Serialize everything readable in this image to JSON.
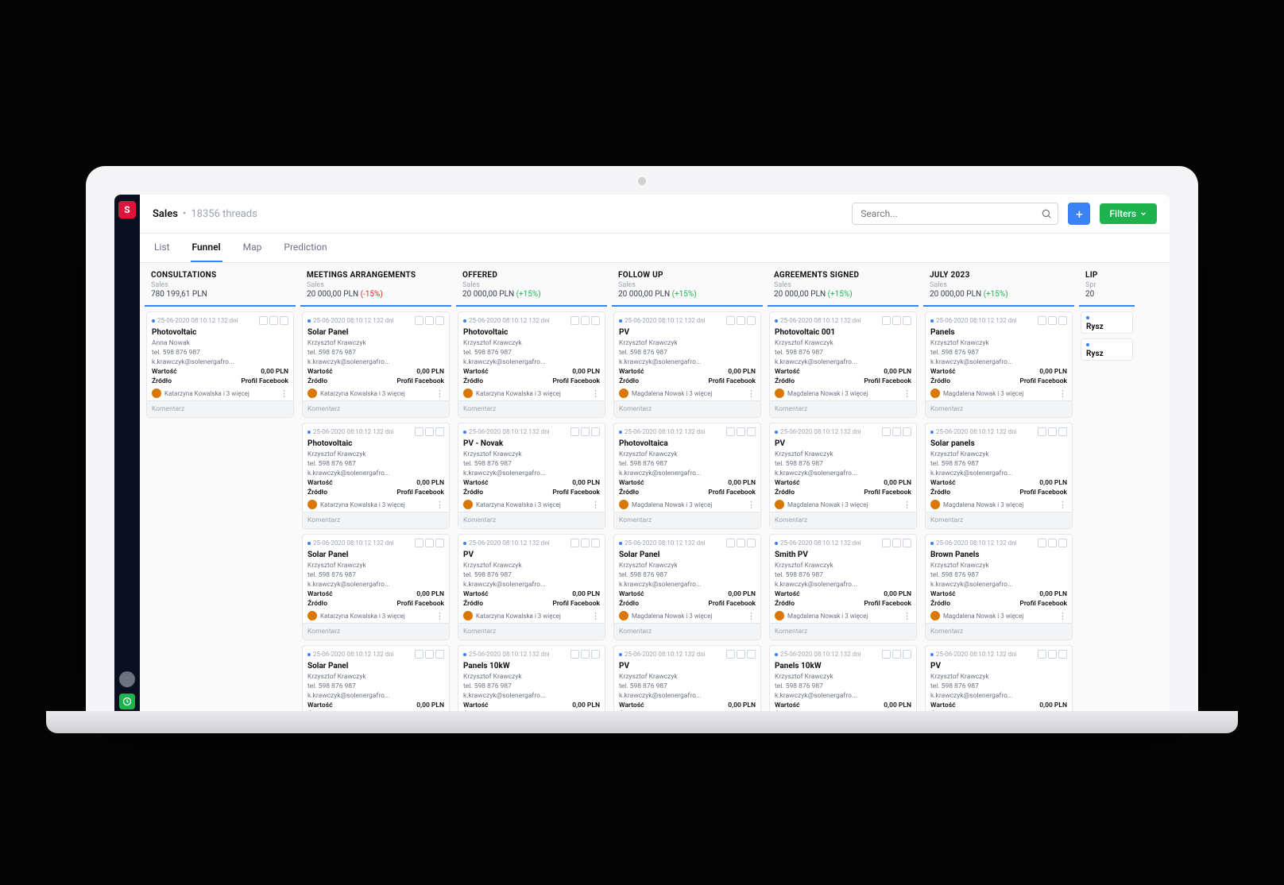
{
  "header": {
    "title": "Sales",
    "threads": "18356 threads",
    "search_ph": "Search...",
    "filters": "Filters",
    "add": "+"
  },
  "tabs": [
    {
      "label": "List"
    },
    {
      "label": "Funnel",
      "active": true
    },
    {
      "label": "Map"
    },
    {
      "label": "Prediction"
    }
  ],
  "card_common": {
    "date": "25-06-2020  08:10:12  132 dni",
    "contact": "Krzysztof Krawczyk",
    "phone": "tel. 598 876 987",
    "email": "k.krawczyk@solenergafro...",
    "wartosc_l": "Wartość",
    "wartosc_v": "0,00 PLN",
    "zrodlo_l": "Źródło",
    "zrodlo_v": "Profil Facebook",
    "komentarz": "Komentarz",
    "assignee_k": "Katarzyna Kowalska i 3 więcej",
    "assignee_m": "Magdalena Nowak i 3 więcej"
  },
  "columns": [
    {
      "name": "CONSULTATIONS",
      "sub": "Sales",
      "value": "780 199,61 PLN",
      "pct": "",
      "bar": "#3b82f6",
      "cards": [
        {
          "title": "Photovoltaic",
          "contact": "Anna Nowak",
          "asn": "k"
        }
      ]
    },
    {
      "name": "MEETINGS ARRANGEMENTS",
      "sub": "Sales",
      "value": "20 000,00 PLN",
      "pct": "(-15%)",
      "pdir": "dn",
      "bar": "#3b82f6",
      "cards": [
        {
          "title": "Solar Panel",
          "asn": "k"
        },
        {
          "title": "Photovoltaic",
          "asn": "k"
        },
        {
          "title": "Solar Panel",
          "asn": "k"
        },
        {
          "title": "Solar Panel",
          "asn": "k"
        }
      ]
    },
    {
      "name": "OFFERED",
      "sub": "Sales",
      "value": "20 000,00 PLN",
      "pct": "(+15%)",
      "pdir": "up",
      "bar": "#3b82f6",
      "cards": [
        {
          "title": "Photovoltaic",
          "asn": "k"
        },
        {
          "title": "PV - Novak",
          "asn": "k"
        },
        {
          "title": "PV",
          "asn": "k"
        },
        {
          "title": "Panels 10kW",
          "asn": "k"
        }
      ]
    },
    {
      "name": "FOLLOW UP",
      "sub": "Sales",
      "value": "20 000,00 PLN",
      "pct": "(+15%)",
      "pdir": "up",
      "bar": "#3b82f6",
      "cards": [
        {
          "title": "PV",
          "asn": "m"
        },
        {
          "title": "Photovoltaica",
          "asn": "m"
        },
        {
          "title": "Solar Panel",
          "asn": "m"
        },
        {
          "title": "PV",
          "asn": "k"
        }
      ]
    },
    {
      "name": "AGREEMENTS SIGNED",
      "sub": "Sales",
      "value": "20 000,00 PLN",
      "pct": "(+15%)",
      "pdir": "up",
      "bar": "#3b82f6",
      "cards": [
        {
          "title": "Photovoltaic 001",
          "asn": "m"
        },
        {
          "title": "PV",
          "asn": "m"
        },
        {
          "title": "Smith PV",
          "asn": "m"
        },
        {
          "title": "Panels 10kW",
          "asn": "k"
        }
      ]
    },
    {
      "name": "JULY 2023",
      "sub": "Sales",
      "value": "20 000,00 PLN",
      "pct": "(+15%)",
      "pdir": "up",
      "bar": "#3b82f6",
      "cards": [
        {
          "title": "Panels",
          "asn": "m"
        },
        {
          "title": "Solar panels",
          "asn": "m"
        },
        {
          "title": "Brown Panels",
          "asn": "m"
        },
        {
          "title": "PV",
          "asn": "m"
        }
      ]
    },
    {
      "name": "LIP",
      "sub": "Spr",
      "value": "20",
      "cut": true,
      "bar": "#3b82f6",
      "cards": [
        {
          "title": "Rysz",
          "stub": true
        },
        {
          "title": "Rysz",
          "stub": true
        }
      ]
    }
  ]
}
